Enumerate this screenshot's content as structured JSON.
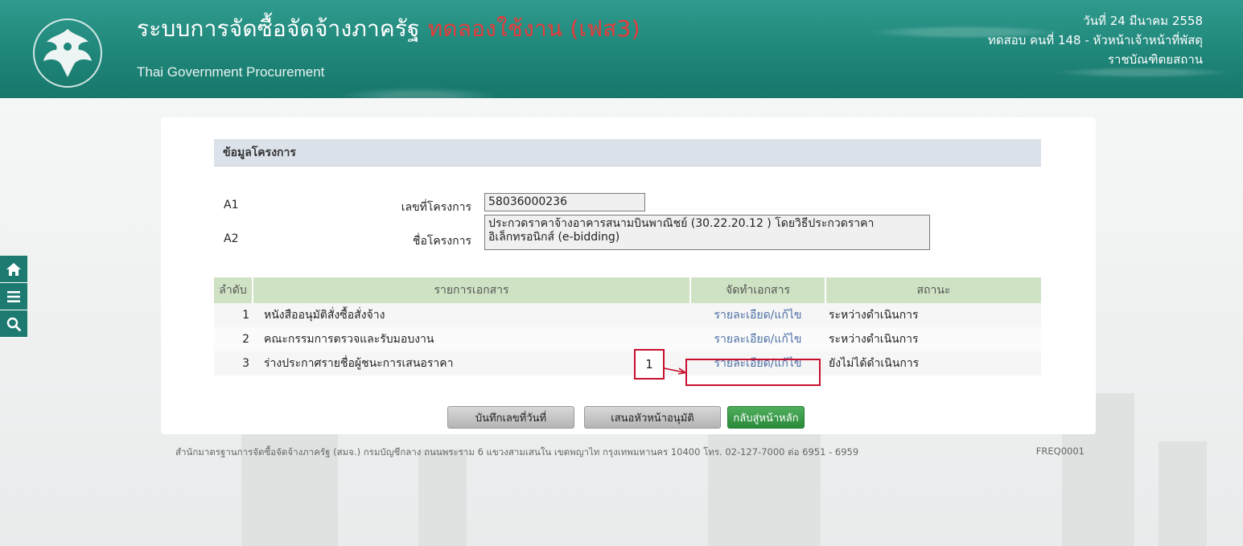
{
  "header": {
    "title_main": "ระบบการจัดซื้อจัดจ้างภาครัฐ",
    "title_accent": "ทดลองใช้งาน (เฟส3)",
    "subtitle": "Thai Government Procurement",
    "date": "วันที่ 24 มีนาคม 2558",
    "user": "ทดสอบ คนที่ 148 - หัวหน้าเจ้าหน้าที่พัสดุ",
    "department": "ราชบัณฑิตยสถาน",
    "logo_icon": "garuda-emblem-icon"
  },
  "sidebar": {
    "items": [
      {
        "icon": "home-icon"
      },
      {
        "icon": "menu-icon"
      },
      {
        "icon": "search-icon"
      }
    ]
  },
  "section": {
    "title": "ข้อมูลโครงการ"
  },
  "fields": {
    "a1_code": "A1",
    "a1_label": "เลขที่โครงการ",
    "a1_value": "58036000236",
    "a2_code": "A2",
    "a2_label": "ชื่อโครงการ",
    "a2_value_line1": "ประกวดราคาจ้างอาคารสนามบินพาณิชย์ (30.22.20.12 ) โดยวิธีประกวดราคา",
    "a2_value_line2": "อิเล็กทรอนิกส์ (e-bidding)"
  },
  "table": {
    "headers": [
      "ลำดับ",
      "รายการเอกสาร",
      "จัดทำเอกสาร",
      "สถานะ"
    ],
    "rows": [
      {
        "no": "1",
        "doc": "หนังสืออนุมัติสั่งซื้อสั่งจ้าง",
        "action": "รายละเอียด/แก้ไข",
        "status": "ระหว่างดำเนินการ"
      },
      {
        "no": "2",
        "doc": "คณะกรรมการตรวจและรับมอบงาน",
        "action": "รายละเอียด/แก้ไข",
        "status": "ระหว่างดำเนินการ"
      },
      {
        "no": "3",
        "doc": "ร่างประกาศรายชื่อผู้ชนะการเสนอราคา",
        "action": "รายละเอียด/แก้ไข",
        "status": "ยังไม่ได้ดำเนินการ"
      }
    ]
  },
  "buttons": {
    "save_date": "บันทึกเลขที่วันที่",
    "propose": "เสนอหัวหน้าอนุมัติ",
    "back": "กลับสู่หน้าหลัก"
  },
  "annotation": {
    "label": "1"
  },
  "footer": {
    "text": "สำนักมาตรฐานการจัดซื้อจัดจ้างภาครัฐ (สมจ.) กรมบัญชีกลาง ถนนพระราม 6 แขวงสามเสนใน เขตพญาไท กรุงเทพมหานคร 10400 โทร. 02-127-7000 ต่อ 6951 - 6959",
    "code": "FREQ0001"
  }
}
